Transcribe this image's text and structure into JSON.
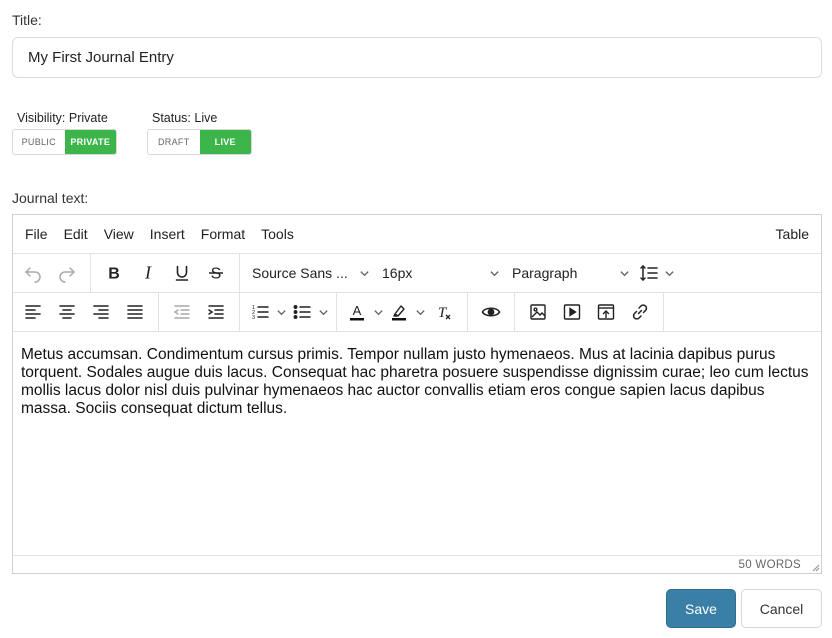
{
  "form": {
    "title_label": "Title:",
    "title_value": "My First Journal Entry",
    "visibility_label": "Visibility: Private",
    "visibility_options": [
      "PUBLIC",
      "PRIVATE"
    ],
    "visibility_selected": "PRIVATE",
    "status_label": "Status: Live",
    "status_options": [
      "DRAFT",
      "LIVE"
    ],
    "status_selected": "LIVE",
    "journal_label": "Journal text:"
  },
  "editor": {
    "menu": [
      "File",
      "Edit",
      "View",
      "Insert",
      "Format",
      "Tools"
    ],
    "menu_right": "Table",
    "font_family": "Source Sans ...",
    "font_size": "16px",
    "block_format": "Paragraph",
    "content": "Metus accumsan. Condimentum cursus primis. Tempor nullam justo hymenaeos. Mus at lacinia dapibus purus torquent. Sodales augue duis lacus. Consequat hac pharetra posuere suspendisse dignissim curae; leo cum lectus mollis lacus dolor nisl duis pulvinar hymenaeos hac auctor convallis etiam eros congue sapien lacus dapibus massa. Sociis consequat dictum tellus.",
    "word_count": "50 WORDS",
    "icons_toolbar1": [
      "undo-icon",
      "redo-icon",
      "bold-icon",
      "italic-icon",
      "underline-icon",
      "strikethrough-icon",
      "line-height-icon"
    ],
    "icons_toolbar2": [
      "align-left-icon",
      "align-center-icon",
      "align-right-icon",
      "align-justify-icon",
      "outdent-icon",
      "indent-icon",
      "numbered-list-icon",
      "bullet-list-icon",
      "text-color-icon",
      "highlight-icon",
      "clear-formatting-icon",
      "preview-icon",
      "image-icon",
      "media-icon",
      "embed-icon",
      "link-icon"
    ]
  },
  "actions": {
    "save_label": "Save",
    "cancel_label": "Cancel"
  },
  "colors": {
    "toggle_on": "#3cb54a",
    "primary": "#3a7fa6"
  }
}
